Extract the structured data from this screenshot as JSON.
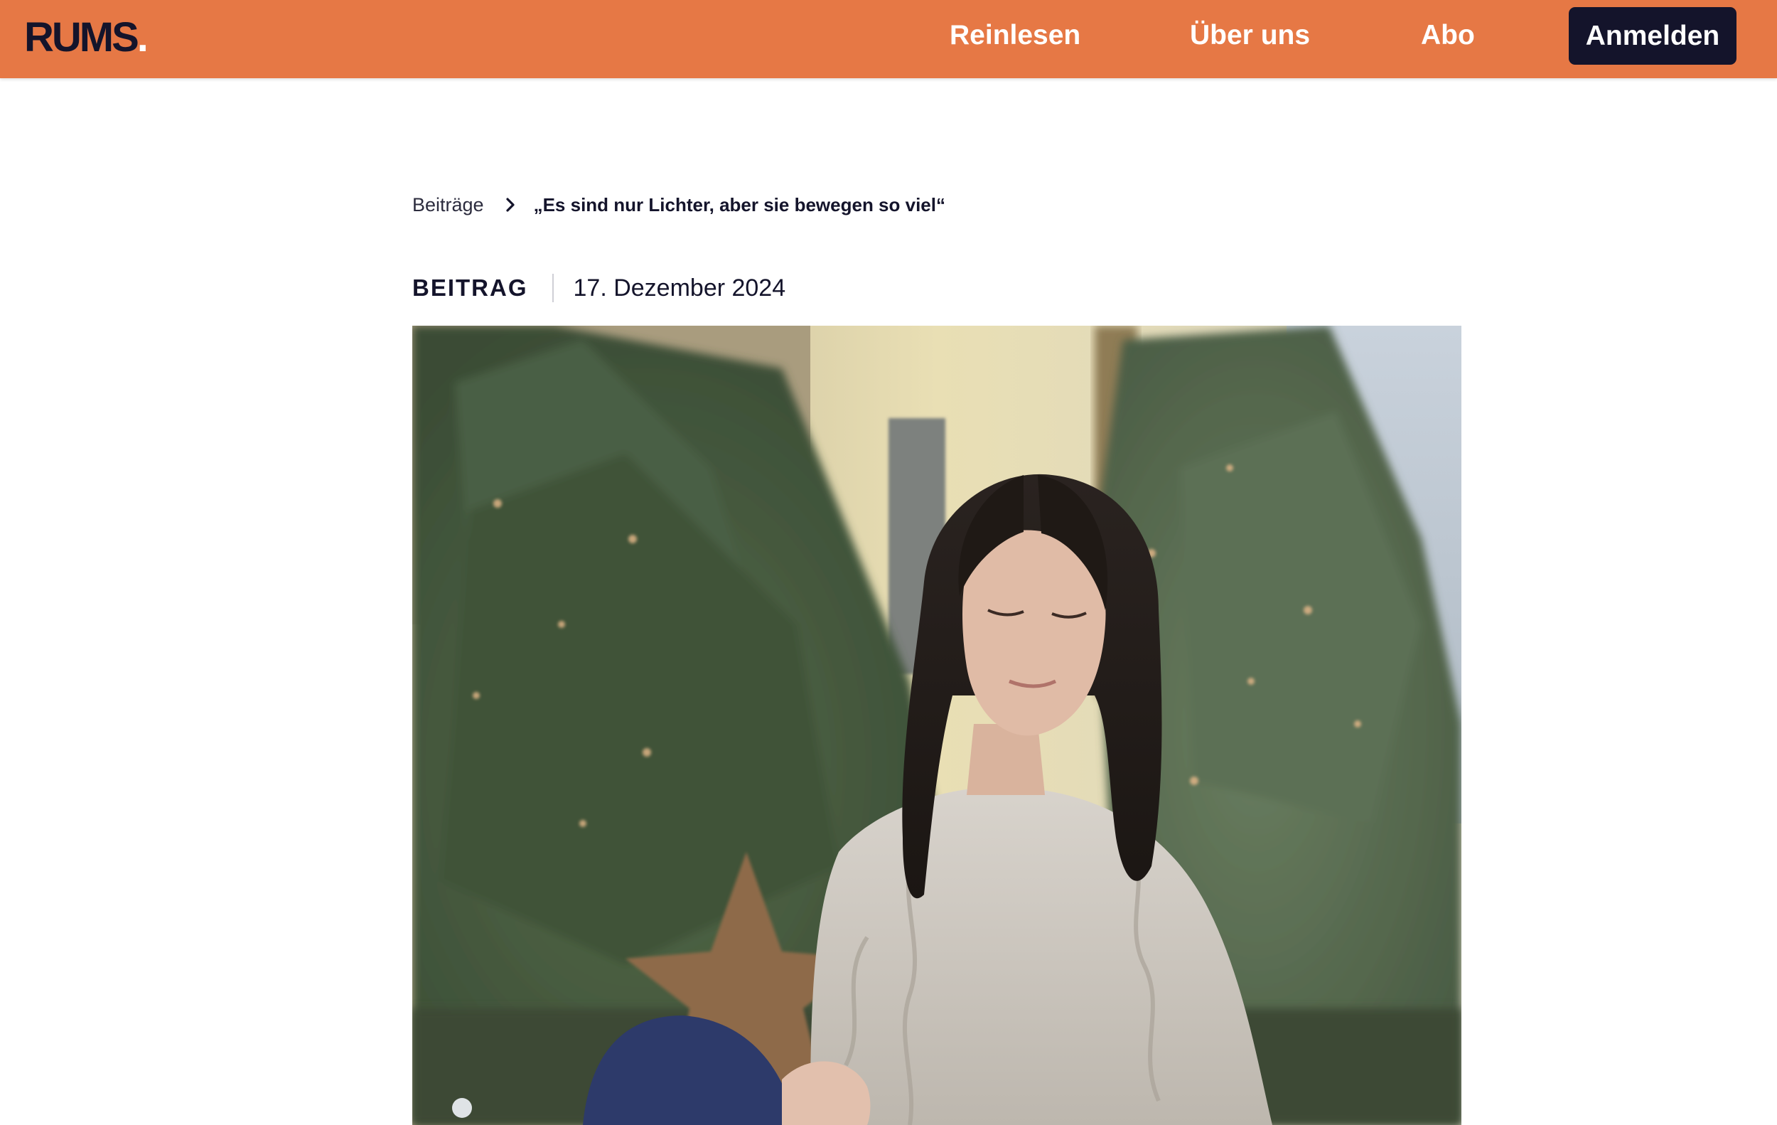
{
  "header": {
    "logo_text": "RUMS",
    "logo_dot": ".",
    "nav": [
      {
        "label": "Reinlesen"
      },
      {
        "label": "Über uns"
      },
      {
        "label": "Abo"
      }
    ],
    "login_label": "Anmelden",
    "colors": {
      "bar": "#e67845",
      "button": "#14142b",
      "text": "#ffffff"
    }
  },
  "breadcrumb": {
    "parent": "Beiträge",
    "current": "„Es sind nur Lichter, aber sie bewegen so viel“",
    "separator_icon": "chevron-right-icon"
  },
  "meta": {
    "category": "BEITRAG",
    "date": "17. Dezember 2024"
  },
  "hero_image": {
    "subject": "photo"
  }
}
